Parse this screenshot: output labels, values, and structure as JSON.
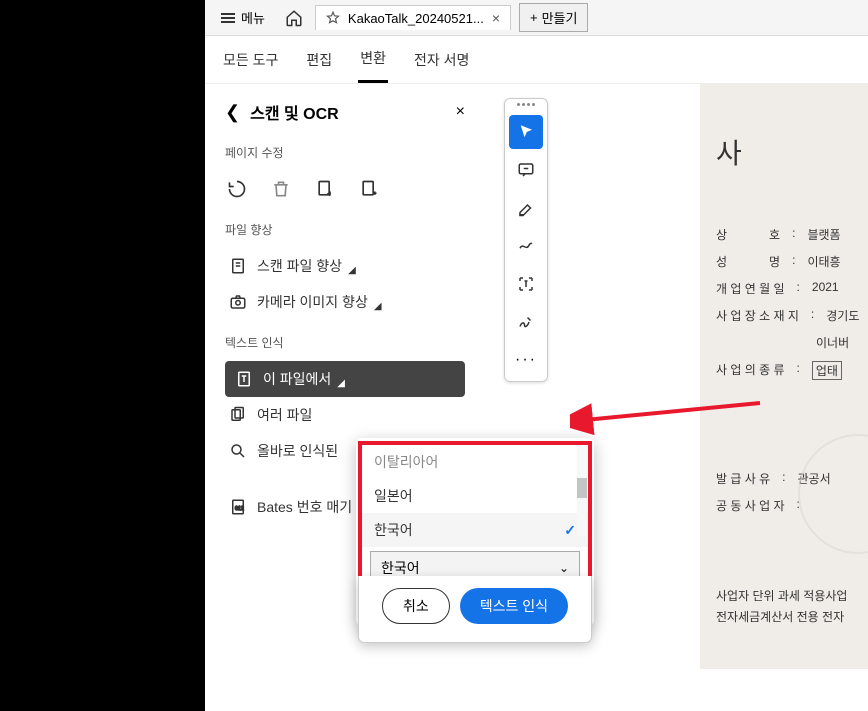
{
  "topbar": {
    "menu_label": "메뉴",
    "tab_title": "KakaoTalk_20240521...",
    "new_tab_label": "만들기"
  },
  "tools": {
    "all_tools": "모든 도구",
    "edit": "편집",
    "convert": "변환",
    "esign": "전자 서명"
  },
  "panel": {
    "title": "스캔 및 OCR",
    "section_page_mod": "페이지 수정",
    "section_file_enhance": "파일 향상",
    "scan_file_enhance": "스캔 파일 향상",
    "camera_enhance": "카메라 이미지 향상",
    "section_text_recog": "텍스트 인식",
    "in_this_file": "이 파일에서",
    "multi_file": "여러 파일",
    "recognize_correct": "올바로 인식된",
    "bates": "Bates 번호 매기"
  },
  "dropdown": {
    "opt_italian": "이탈리아어",
    "opt_japanese": "일본어",
    "opt_korean": "한국어",
    "selected": "한국어"
  },
  "dialog": {
    "cancel": "취소",
    "recognize": "텍스트 인식"
  },
  "document": {
    "title_char": "사",
    "row1_label": "상",
    "row1_label2": "호",
    "row1_value": "블랫폼",
    "row2_label": "성",
    "row2_label2": "명",
    "row2_value": "이태흥",
    "row3_label": "개 업 연 월 일",
    "row3_value": "2021",
    "row4_label": "사 업 장 소 재 지",
    "row4_value": "경기도",
    "row4_value2": "이너버",
    "row5_label": "사 업 의 종 류",
    "row5_value": "업태",
    "row6_label": "발 급 사 유",
    "row6_value": "관공서",
    "row7_label": "공 동 사 업 자",
    "bottom_line1": "사업자 단위 과세 적용사업",
    "bottom_line2": "전자세금계산서 전용 전자"
  }
}
